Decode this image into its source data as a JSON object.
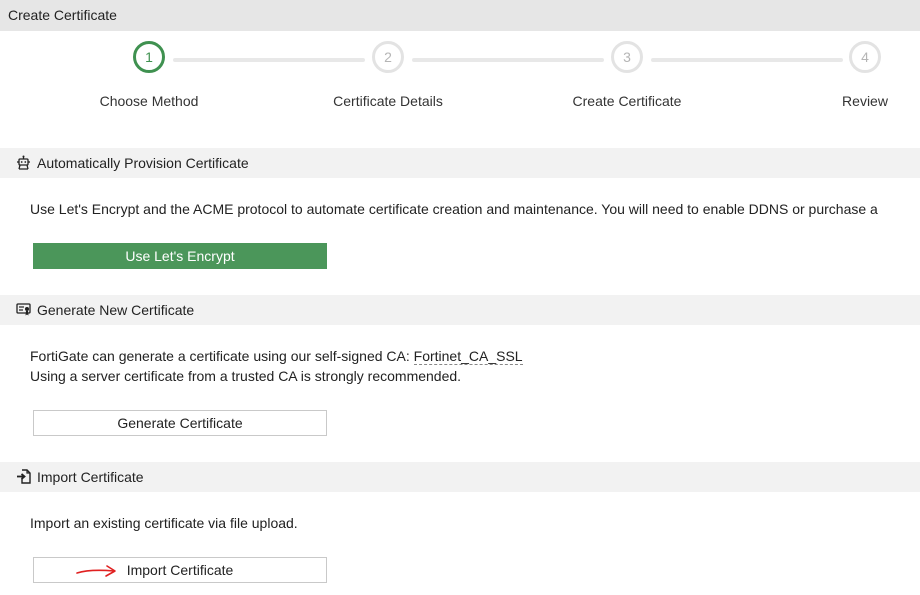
{
  "window": {
    "title": "Create Certificate"
  },
  "stepper": {
    "steps": [
      {
        "number": "1",
        "label": "Choose Method",
        "active": true
      },
      {
        "number": "2",
        "label": "Certificate Details",
        "active": false
      },
      {
        "number": "3",
        "label": "Create Certificate",
        "active": false
      },
      {
        "number": "4",
        "label": "Review",
        "active": false
      }
    ]
  },
  "sections": {
    "auto": {
      "title": "Automatically Provision Certificate",
      "icon": "robot-icon",
      "description": "Use Let's Encrypt and the ACME protocol to automate certificate creation and maintenance. You will need to enable DDNS or purchase a",
      "button_label": "Use Let's Encrypt"
    },
    "generate": {
      "title": "Generate New Certificate",
      "icon": "certificate-icon",
      "description_prefix": "FortiGate can generate a certificate using our self-signed CA: ",
      "ca_link": "Fortinet_CA_SSL",
      "description_line2": "Using a server certificate from a trusted CA is strongly recommended.",
      "button_label": "Generate Certificate"
    },
    "import": {
      "title": "Import Certificate",
      "icon": "import-file-icon",
      "description": "Import an existing certificate via file upload.",
      "button_label": "Import Certificate"
    }
  },
  "colors": {
    "accent": "#3f9150",
    "primary_button": "#4b965a",
    "annotation_arrow": "#e02020"
  }
}
